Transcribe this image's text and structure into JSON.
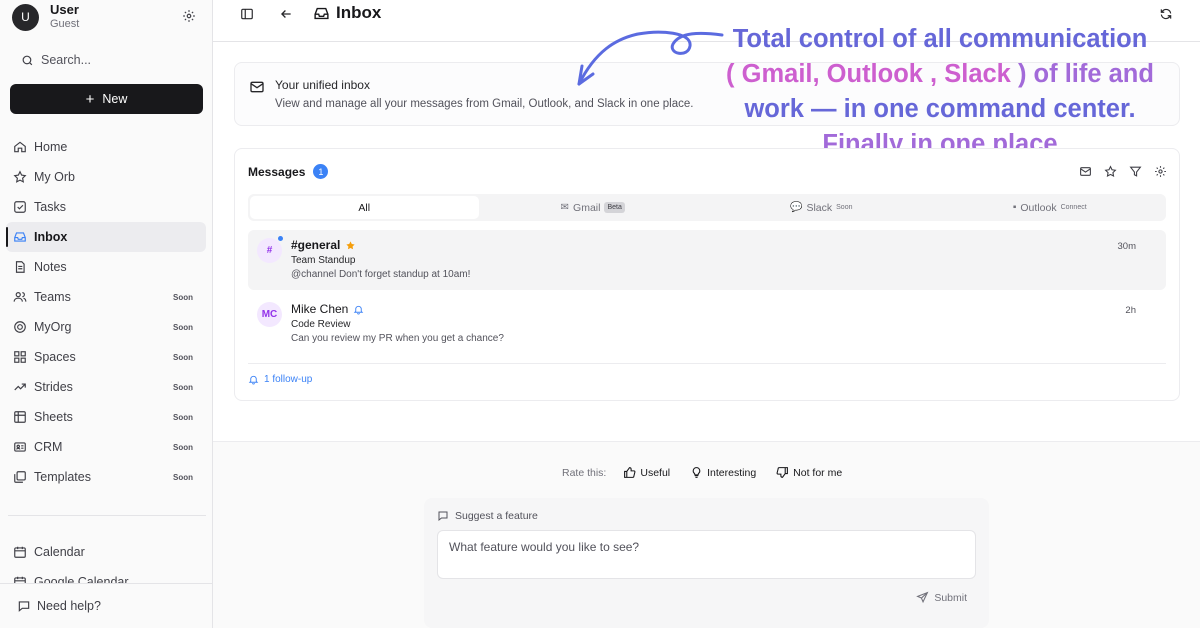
{
  "user": {
    "initial": "U",
    "name": "User",
    "role": "Guest"
  },
  "sidebar": {
    "search_label": "Search...",
    "new_label": "New",
    "items": [
      {
        "label": "Home",
        "icon": "home-icon",
        "soon": ""
      },
      {
        "label": "My Orb",
        "icon": "star-icon",
        "soon": ""
      },
      {
        "label": "Tasks",
        "icon": "checkbox-icon",
        "soon": ""
      },
      {
        "label": "Inbox",
        "icon": "inbox-icon",
        "soon": "",
        "active": true
      },
      {
        "label": "Notes",
        "icon": "note-icon",
        "soon": ""
      },
      {
        "label": "Teams",
        "icon": "users-icon",
        "soon": "Soon"
      },
      {
        "label": "MyOrg",
        "icon": "org-icon",
        "soon": "Soon"
      },
      {
        "label": "Spaces",
        "icon": "grid-icon",
        "soon": "Soon"
      },
      {
        "label": "Strides",
        "icon": "trend-icon",
        "soon": "Soon"
      },
      {
        "label": "Sheets",
        "icon": "sheet-icon",
        "soon": "Soon"
      },
      {
        "label": "CRM",
        "icon": "crm-icon",
        "soon": "Soon"
      },
      {
        "label": "Templates",
        "icon": "template-icon",
        "soon": "Soon"
      }
    ],
    "secondary": [
      {
        "label": "Calendar",
        "icon": "calendar-icon"
      },
      {
        "label": "Google Calendar",
        "icon": "calendar-icon"
      }
    ],
    "help_label": "Need help?"
  },
  "header": {
    "title": "Inbox"
  },
  "info": {
    "title": "Your unified inbox",
    "description": "View and manage all your messages from Gmail, Outlook, and Slack in one place."
  },
  "annotation": {
    "line1": "Total control of all communication",
    "line2_open": "( ",
    "line2_pink": "Gmail, Outlook , Slack",
    "line2_close": "  ) of life and",
    "line3": "work — in one command center.",
    "line4": "Finally in one place"
  },
  "messages": {
    "heading": "Messages",
    "count": "1",
    "tabs": [
      {
        "label": "All",
        "tag": "",
        "glyph": ""
      },
      {
        "label": "Gmail",
        "tag": "Beta",
        "glyph": "✉"
      },
      {
        "label": "Slack",
        "tag": "Soon",
        "glyph": "💬"
      },
      {
        "label": "Outlook",
        "tag": "Connect",
        "glyph": "▪"
      }
    ],
    "rows": [
      {
        "avatar": "#",
        "name": "#general",
        "subject": "Team Standup",
        "preview": "@channel Don't forget standup at 10am!",
        "time": "30m"
      },
      {
        "avatar": "MC",
        "name": "Mike Chen",
        "subject": "Code Review",
        "preview": "Can you review my PR when you get a chance?",
        "time": "2h"
      }
    ],
    "follow_up": "1 follow-up"
  },
  "feedback": {
    "rate_label": "Rate this:",
    "options": [
      "Useful",
      "Interesting",
      "Not for me"
    ],
    "suggest_label": "Suggest a feature",
    "placeholder": "What feature would you like to see?",
    "submit_label": "Submit"
  },
  "colors": {
    "accent": "#3b82f6",
    "annotation_blue": "#6667d8",
    "annotation_pink": "#cd5fcf",
    "annotation_violet": "#a26ad9"
  }
}
